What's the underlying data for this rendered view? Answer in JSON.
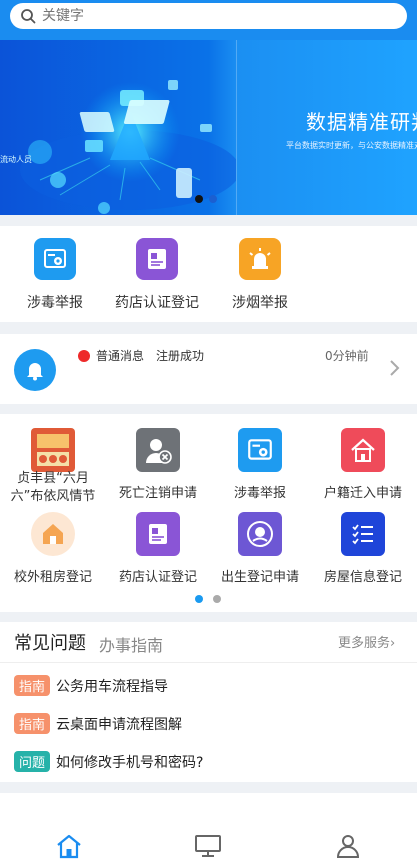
{
  "search": {
    "placeholder": "关键字"
  },
  "banner": {
    "headline": "数据精准研判",
    "subtext": "平台数据实时更新，与公安数据精准对接",
    "left_text": "流动人员",
    "active_slide": 1
  },
  "quick_services": [
    {
      "label": "涉毒举报",
      "icon": "camera-report-icon",
      "color": "#1e9bf0"
    },
    {
      "label": "药店认证登记",
      "icon": "id-card-icon",
      "color": "#8a55d6"
    },
    {
      "label": "涉烟举报",
      "icon": "alarm-light-icon",
      "color": "#f7a425"
    }
  ],
  "notice": {
    "type": "普通消息",
    "text": "注册成功",
    "time": "0分钟前"
  },
  "grid_services": [
    {
      "label": "贞丰县“六月六”布依风情节",
      "icon": "festival-poster-icon",
      "color": "#e05a37"
    },
    {
      "label": "死亡注销申请",
      "icon": "person-cancel-icon",
      "color": "#6e7277"
    },
    {
      "label": "涉毒举报",
      "icon": "camera-report-icon",
      "color": "#1e9bf0"
    },
    {
      "label": "户籍迁入申请",
      "icon": "house-move-icon",
      "color": "#ef4b5a"
    },
    {
      "label": "校外租房登记",
      "icon": "rental-house-icon",
      "color": "#f5a552"
    },
    {
      "label": "药店认证登记",
      "icon": "id-card-icon",
      "color": "#8a55d6"
    },
    {
      "label": "出生登记申请",
      "icon": "baby-icon",
      "color": "#6d57d4"
    },
    {
      "label": "房屋信息登记",
      "icon": "checklist-icon",
      "color": "#1f45d9"
    }
  ],
  "grid_page": {
    "current": 1,
    "total": 2
  },
  "faq": {
    "title": "常见问题",
    "tab": "办事指南",
    "more": "更多服务›",
    "items": [
      {
        "tag": "指南",
        "tag_color": "#f6916b",
        "text": "公务用车流程指导"
      },
      {
        "tag": "指南",
        "tag_color": "#f6916b",
        "text": "云桌面申请流程图解"
      },
      {
        "tag": "问题",
        "tag_color": "#26b2a9",
        "text": "如何修改手机号和密码?"
      }
    ]
  },
  "tabbar": {
    "active": "home",
    "accent": "#1a8cf0",
    "icons": [
      "home-icon",
      "monitor-icon",
      "user-icon"
    ]
  }
}
